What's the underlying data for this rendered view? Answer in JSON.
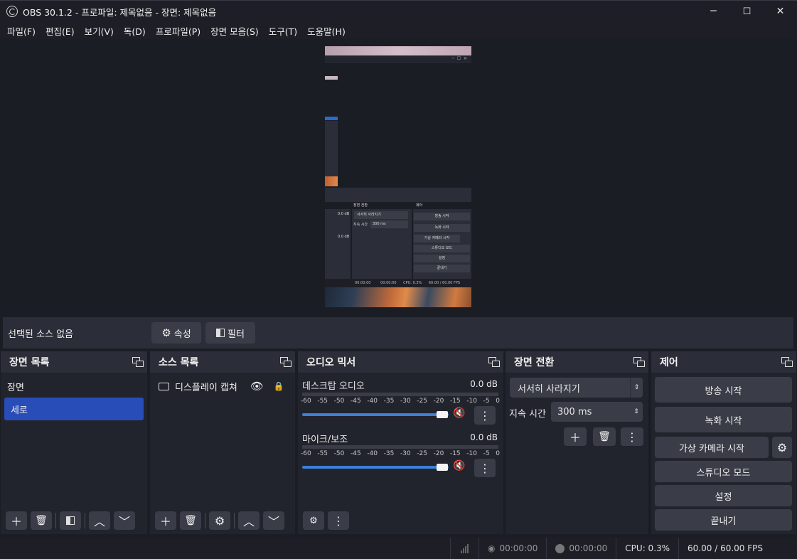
{
  "window": {
    "title": "OBS 30.1.2 - 프로파일: 제목없음 - 장면: 제목없음",
    "minimize": "─",
    "maximize": "☐",
    "close": "✕"
  },
  "menu": [
    "파일(F)",
    "편집(E)",
    "보기(V)",
    "독(D)",
    "프로파일(P)",
    "장면 모음(S)",
    "도구(T)",
    "도움말(H)"
  ],
  "preview_mini": {
    "transition_title": "장면 전환",
    "controls_title": "제어",
    "fade": "서서히 사라지기",
    "duration_label": "지속 시간",
    "duration": "300 ms",
    "db1": "0.0 dB",
    "db2": "0.0 dB",
    "btn_stream": "방송 시작",
    "btn_record": "녹화 시작",
    "btn_vcam": "가상 카메라 시작",
    "btn_studio": "스튜디오 모드",
    "btn_settings": "설정",
    "btn_exit": "끝내기",
    "stat_t1": "00:00:00",
    "stat_t2": "00:00:00",
    "stat_cpu": "CPU: 0.3%",
    "stat_fps": "60.00 / 60.00 FPS"
  },
  "propbar": {
    "label": "선택된 소스 없음",
    "properties": "속성",
    "filters": "필터"
  },
  "scenes": {
    "title": "장면 목록",
    "items": [
      "장면",
      "세로"
    ],
    "selected_index": 1
  },
  "sources": {
    "title": "소스 목록",
    "items": [
      {
        "name": "디스플레이 캡쳐",
        "visible": true,
        "locked": true
      }
    ]
  },
  "mixer": {
    "title": "오디오 믹서",
    "ticks": [
      "-60",
      "-55",
      "-50",
      "-45",
      "-40",
      "-35",
      "-30",
      "-25",
      "-20",
      "-15",
      "-10",
      "-5",
      "0"
    ],
    "channels": [
      {
        "name": "데스크탑 오디오",
        "db": "0.0 dB",
        "volume": 1.0,
        "muted": true
      },
      {
        "name": "마이크/보조",
        "db": "0.0 dB",
        "volume": 1.0,
        "muted": true
      }
    ]
  },
  "transitions": {
    "title": "장면 전환",
    "selected": "서서히 사라지기",
    "duration_label": "지속 시간",
    "duration": "300 ms"
  },
  "controls": {
    "title": "제어",
    "start_stream": "방송 시작",
    "start_recording": "녹화 시작",
    "start_virtual_camera": "가상 카메라 시작",
    "studio_mode": "스튜디오 모드",
    "settings": "설정",
    "exit": "끝내기"
  },
  "status": {
    "stream_time": "00:00:00",
    "record_time": "00:00:00",
    "cpu": "CPU: 0.3%",
    "fps": "60.00 / 60.00 FPS"
  },
  "colors": {
    "accent": "#284cb8",
    "mute": "#d03030",
    "slider": "#3b7fd6"
  }
}
